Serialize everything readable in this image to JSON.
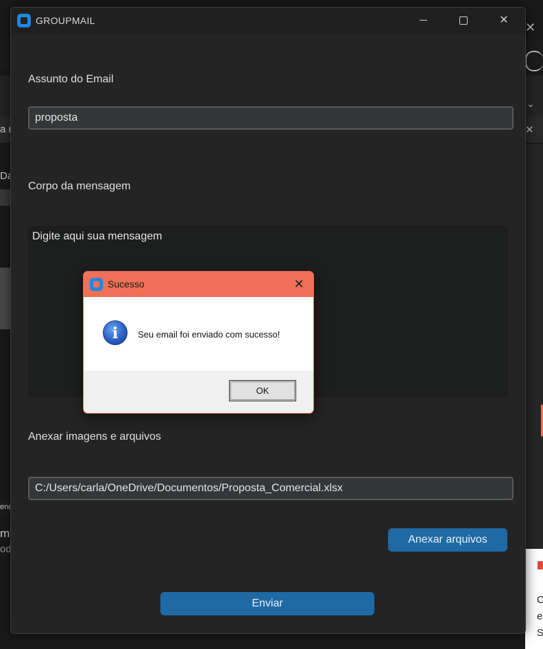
{
  "window": {
    "title": "GROUPMAIL"
  },
  "subject": {
    "label": "Assunto do Email",
    "value": "proposta"
  },
  "body_section": {
    "label": "Corpo da mensagem",
    "value": "Digite aqui sua mensagem"
  },
  "attachments": {
    "label": "Anexar imagens e arquivos",
    "path": "C:/Users/carla/OneDrive/Documentos/Proposta_Comercial.xlsx",
    "attach_button": "Anexar arquivos"
  },
  "send_button": "Enviar",
  "dialog": {
    "title": "Sucesso",
    "message": "Seu email foi enviado com sucesso!",
    "ok_label": "OK",
    "icon": "info-icon"
  },
  "background": {
    "fragments": [
      "a r",
      "Da",
      "enc",
      "mí",
      "od",
      "C",
      "e",
      "S"
    ]
  },
  "colors": {
    "accent": "#1f6aa5",
    "dialog_titlebar": "#f07058",
    "app_icon": "#1e88e5"
  }
}
